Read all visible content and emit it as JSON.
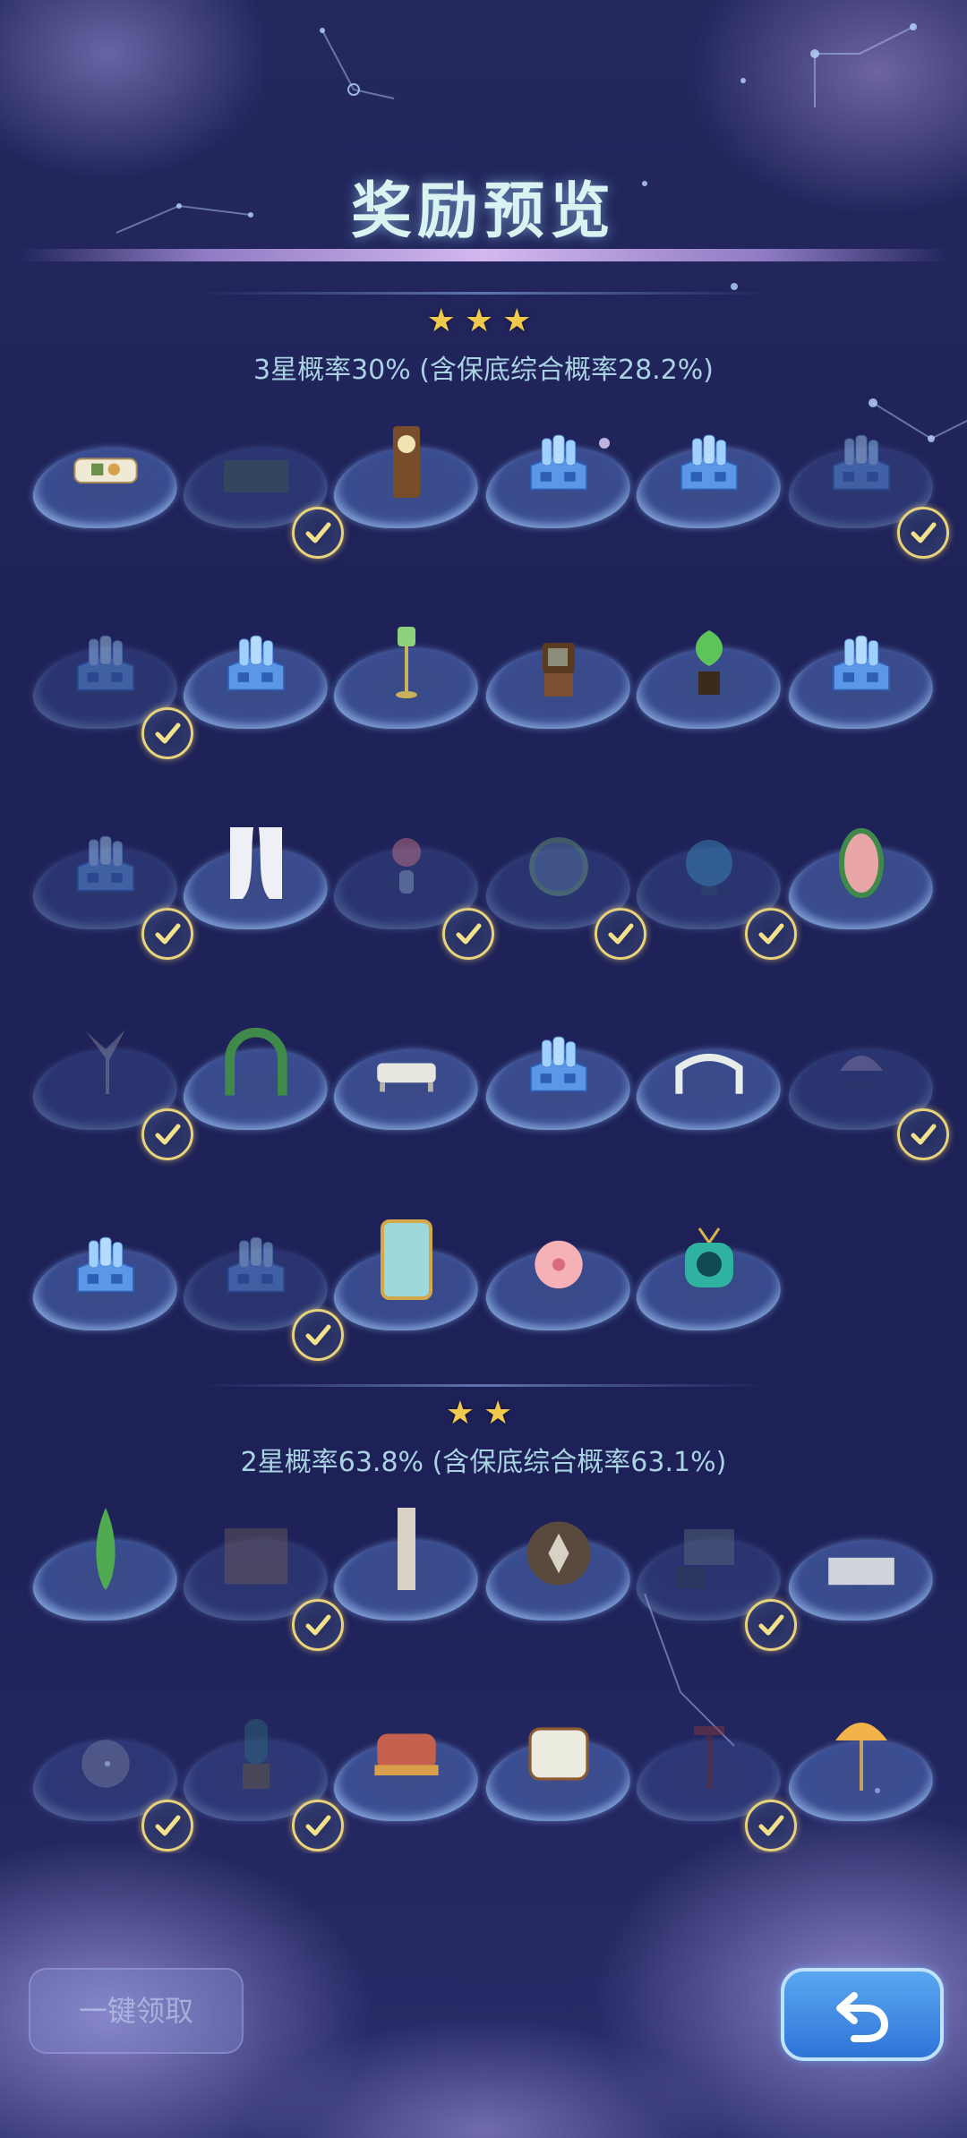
{
  "header": {
    "title": "奖励预览"
  },
  "tiers": [
    {
      "stars": "★★★",
      "label": "3星概率30% (含保底综合概率28.2%)"
    },
    {
      "stars": "★★",
      "label": "2星概率63.8% (含保底综合概率63.1%)"
    }
  ],
  "items_tier3": [
    {
      "icon": "sofa-icon",
      "claimed": false
    },
    {
      "icon": "rug-icon",
      "claimed": true
    },
    {
      "icon": "grandfather-clock-icon",
      "claimed": false
    },
    {
      "icon": "blueprint-box-icon",
      "claimed": false
    },
    {
      "icon": "blueprint-box-icon",
      "claimed": false
    },
    {
      "icon": "blueprint-box-icon",
      "claimed": true
    },
    {
      "icon": "blueprint-box-icon",
      "claimed": true
    },
    {
      "icon": "blueprint-box-icon",
      "claimed": false
    },
    {
      "icon": "lamp-post-icon",
      "claimed": false
    },
    {
      "icon": "vintage-tv-icon",
      "claimed": false
    },
    {
      "icon": "potted-plant-icon",
      "claimed": false
    },
    {
      "icon": "blueprint-box-icon",
      "claimed": false
    },
    {
      "icon": "blueprint-box-icon",
      "claimed": true
    },
    {
      "icon": "curtain-icon",
      "claimed": false
    },
    {
      "icon": "flower-vase-icon",
      "claimed": true
    },
    {
      "icon": "floral-wreath-icon",
      "claimed": true
    },
    {
      "icon": "globe-icon",
      "claimed": true
    },
    {
      "icon": "flower-egg-icon",
      "claimed": false
    },
    {
      "icon": "bird-statue-icon",
      "claimed": true
    },
    {
      "icon": "vine-arch-icon",
      "claimed": false
    },
    {
      "icon": "garden-bench-icon",
      "claimed": false
    },
    {
      "icon": "blueprint-box-icon",
      "claimed": false
    },
    {
      "icon": "garden-gate-icon",
      "claimed": false
    },
    {
      "icon": "gazebo-icon",
      "claimed": true
    },
    {
      "icon": "blueprint-box-icon",
      "claimed": false
    },
    {
      "icon": "blueprint-box-icon",
      "claimed": true
    },
    {
      "icon": "wardrobe-icon",
      "claimed": false
    },
    {
      "icon": "sakura-flower-icon",
      "claimed": false
    },
    {
      "icon": "retro-tv-icon",
      "claimed": false
    }
  ],
  "items_tier2": [
    {
      "icon": "cypress-tree-icon",
      "claimed": false
    },
    {
      "icon": "wooden-fence-icon",
      "claimed": true
    },
    {
      "icon": "wall-panel-icon",
      "claimed": false
    },
    {
      "icon": "stone-medallion-icon",
      "claimed": false
    },
    {
      "icon": "picture-frame-icon",
      "claimed": true
    },
    {
      "icon": "wall-tile-icon",
      "claimed": false
    },
    {
      "icon": "flower-rug-icon",
      "claimed": true
    },
    {
      "icon": "chair-icon",
      "claimed": true
    },
    {
      "icon": "ottoman-icon",
      "claimed": false
    },
    {
      "icon": "armchair-icon",
      "claimed": false
    },
    {
      "icon": "side-table-icon",
      "claimed": true
    },
    {
      "icon": "parasol-icon",
      "claimed": false
    }
  ],
  "footer": {
    "claim_all_label": "一键领取",
    "back_icon": "back-arrow-icon"
  },
  "colors": {
    "accent": "#f1c94d",
    "check": "#e8d27a",
    "back_button": "#3f87e2"
  }
}
